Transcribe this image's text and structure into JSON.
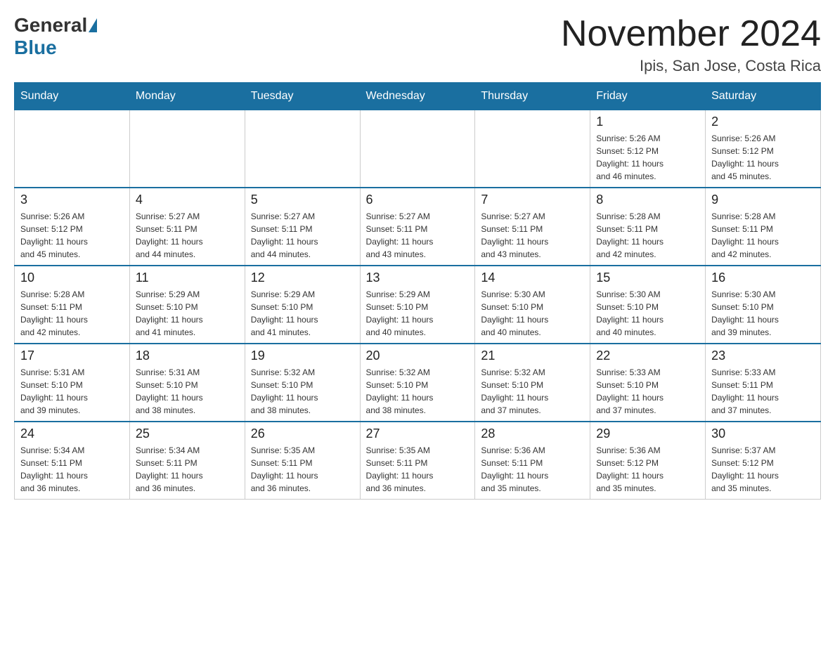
{
  "logo": {
    "general": "General",
    "blue": "Blue"
  },
  "title": "November 2024",
  "subtitle": "Ipis, San Jose, Costa Rica",
  "days_of_week": [
    "Sunday",
    "Monday",
    "Tuesday",
    "Wednesday",
    "Thursday",
    "Friday",
    "Saturday"
  ],
  "weeks": [
    [
      {
        "day": "",
        "info": ""
      },
      {
        "day": "",
        "info": ""
      },
      {
        "day": "",
        "info": ""
      },
      {
        "day": "",
        "info": ""
      },
      {
        "day": "",
        "info": ""
      },
      {
        "day": "1",
        "info": "Sunrise: 5:26 AM\nSunset: 5:12 PM\nDaylight: 11 hours\nand 46 minutes."
      },
      {
        "day": "2",
        "info": "Sunrise: 5:26 AM\nSunset: 5:12 PM\nDaylight: 11 hours\nand 45 minutes."
      }
    ],
    [
      {
        "day": "3",
        "info": "Sunrise: 5:26 AM\nSunset: 5:12 PM\nDaylight: 11 hours\nand 45 minutes."
      },
      {
        "day": "4",
        "info": "Sunrise: 5:27 AM\nSunset: 5:11 PM\nDaylight: 11 hours\nand 44 minutes."
      },
      {
        "day": "5",
        "info": "Sunrise: 5:27 AM\nSunset: 5:11 PM\nDaylight: 11 hours\nand 44 minutes."
      },
      {
        "day": "6",
        "info": "Sunrise: 5:27 AM\nSunset: 5:11 PM\nDaylight: 11 hours\nand 43 minutes."
      },
      {
        "day": "7",
        "info": "Sunrise: 5:27 AM\nSunset: 5:11 PM\nDaylight: 11 hours\nand 43 minutes."
      },
      {
        "day": "8",
        "info": "Sunrise: 5:28 AM\nSunset: 5:11 PM\nDaylight: 11 hours\nand 42 minutes."
      },
      {
        "day": "9",
        "info": "Sunrise: 5:28 AM\nSunset: 5:11 PM\nDaylight: 11 hours\nand 42 minutes."
      }
    ],
    [
      {
        "day": "10",
        "info": "Sunrise: 5:28 AM\nSunset: 5:11 PM\nDaylight: 11 hours\nand 42 minutes."
      },
      {
        "day": "11",
        "info": "Sunrise: 5:29 AM\nSunset: 5:10 PM\nDaylight: 11 hours\nand 41 minutes."
      },
      {
        "day": "12",
        "info": "Sunrise: 5:29 AM\nSunset: 5:10 PM\nDaylight: 11 hours\nand 41 minutes."
      },
      {
        "day": "13",
        "info": "Sunrise: 5:29 AM\nSunset: 5:10 PM\nDaylight: 11 hours\nand 40 minutes."
      },
      {
        "day": "14",
        "info": "Sunrise: 5:30 AM\nSunset: 5:10 PM\nDaylight: 11 hours\nand 40 minutes."
      },
      {
        "day": "15",
        "info": "Sunrise: 5:30 AM\nSunset: 5:10 PM\nDaylight: 11 hours\nand 40 minutes."
      },
      {
        "day": "16",
        "info": "Sunrise: 5:30 AM\nSunset: 5:10 PM\nDaylight: 11 hours\nand 39 minutes."
      }
    ],
    [
      {
        "day": "17",
        "info": "Sunrise: 5:31 AM\nSunset: 5:10 PM\nDaylight: 11 hours\nand 39 minutes."
      },
      {
        "day": "18",
        "info": "Sunrise: 5:31 AM\nSunset: 5:10 PM\nDaylight: 11 hours\nand 38 minutes."
      },
      {
        "day": "19",
        "info": "Sunrise: 5:32 AM\nSunset: 5:10 PM\nDaylight: 11 hours\nand 38 minutes."
      },
      {
        "day": "20",
        "info": "Sunrise: 5:32 AM\nSunset: 5:10 PM\nDaylight: 11 hours\nand 38 minutes."
      },
      {
        "day": "21",
        "info": "Sunrise: 5:32 AM\nSunset: 5:10 PM\nDaylight: 11 hours\nand 37 minutes."
      },
      {
        "day": "22",
        "info": "Sunrise: 5:33 AM\nSunset: 5:10 PM\nDaylight: 11 hours\nand 37 minutes."
      },
      {
        "day": "23",
        "info": "Sunrise: 5:33 AM\nSunset: 5:11 PM\nDaylight: 11 hours\nand 37 minutes."
      }
    ],
    [
      {
        "day": "24",
        "info": "Sunrise: 5:34 AM\nSunset: 5:11 PM\nDaylight: 11 hours\nand 36 minutes."
      },
      {
        "day": "25",
        "info": "Sunrise: 5:34 AM\nSunset: 5:11 PM\nDaylight: 11 hours\nand 36 minutes."
      },
      {
        "day": "26",
        "info": "Sunrise: 5:35 AM\nSunset: 5:11 PM\nDaylight: 11 hours\nand 36 minutes."
      },
      {
        "day": "27",
        "info": "Sunrise: 5:35 AM\nSunset: 5:11 PM\nDaylight: 11 hours\nand 36 minutes."
      },
      {
        "day": "28",
        "info": "Sunrise: 5:36 AM\nSunset: 5:11 PM\nDaylight: 11 hours\nand 35 minutes."
      },
      {
        "day": "29",
        "info": "Sunrise: 5:36 AM\nSunset: 5:12 PM\nDaylight: 11 hours\nand 35 minutes."
      },
      {
        "day": "30",
        "info": "Sunrise: 5:37 AM\nSunset: 5:12 PM\nDaylight: 11 hours\nand 35 minutes."
      }
    ]
  ]
}
